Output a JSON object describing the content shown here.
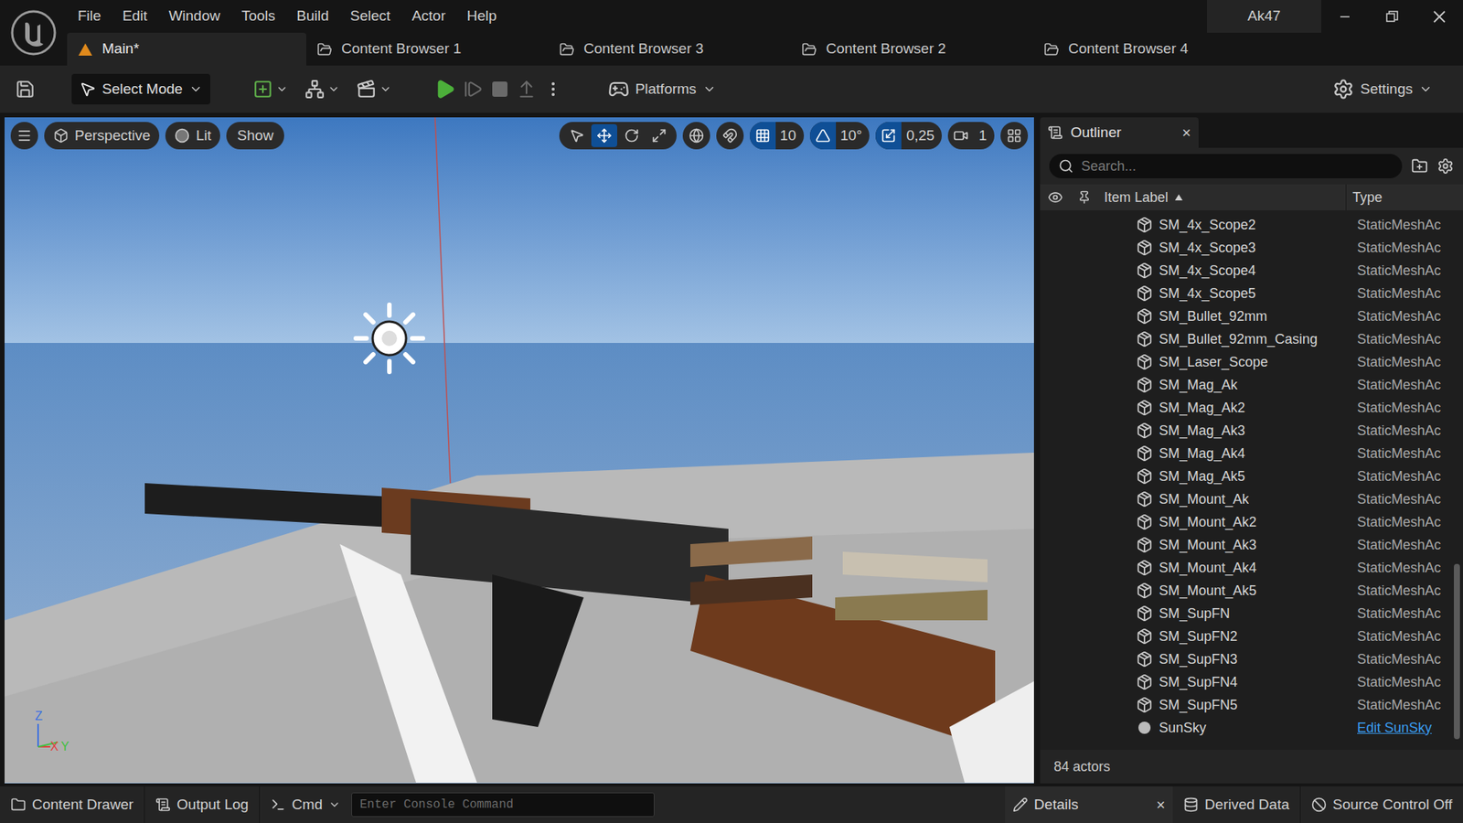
{
  "window": {
    "title": "Ak47"
  },
  "menu": [
    "File",
    "Edit",
    "Window",
    "Tools",
    "Build",
    "Select",
    "Actor",
    "Help"
  ],
  "tabs": [
    {
      "label": "Main*",
      "selected": true
    },
    {
      "label": "Content Browser 1",
      "selected": false
    },
    {
      "label": "Content Browser 3",
      "selected": false
    },
    {
      "label": "Content Browser 2",
      "selected": false
    },
    {
      "label": "Content Browser 4",
      "selected": false
    }
  ],
  "toolbar": {
    "mode": "Select Mode",
    "platforms": "Platforms",
    "settings": "Settings"
  },
  "viewport": {
    "view": "Perspective",
    "lighting": "Lit",
    "show": "Show",
    "transform_tools": [
      {
        "kind": "select",
        "selected": false
      },
      {
        "kind": "translate",
        "selected": true
      },
      {
        "kind": "rotate",
        "selected": false
      },
      {
        "kind": "scale",
        "selected": false
      }
    ],
    "snaps": [
      {
        "kind": "grid",
        "value": "10",
        "active": true
      },
      {
        "kind": "angle",
        "value": "10°",
        "active": true
      },
      {
        "kind": "scale",
        "value": "0,25",
        "active": true
      },
      {
        "kind": "camera",
        "value": "1",
        "active": false
      }
    ],
    "axes": [
      "Z",
      "X",
      "Y"
    ]
  },
  "outliner": {
    "title": "Outliner",
    "close": "×",
    "search_placeholder": "Search...",
    "columns": [
      "Item Label",
      "Type"
    ],
    "rows": [
      {
        "label": "SM_4x_Scope2",
        "type": "StaticMeshAc",
        "kind": "mesh"
      },
      {
        "label": "SM_4x_Scope3",
        "type": "StaticMeshAc",
        "kind": "mesh"
      },
      {
        "label": "SM_4x_Scope4",
        "type": "StaticMeshAc",
        "kind": "mesh"
      },
      {
        "label": "SM_4x_Scope5",
        "type": "StaticMeshAc",
        "kind": "mesh"
      },
      {
        "label": "SM_Bullet_92mm",
        "type": "StaticMeshAc",
        "kind": "mesh"
      },
      {
        "label": "SM_Bullet_92mm_Casing",
        "type": "StaticMeshAc",
        "kind": "mesh"
      },
      {
        "label": "SM_Laser_Scope",
        "type": "StaticMeshAc",
        "kind": "mesh"
      },
      {
        "label": "SM_Mag_Ak",
        "type": "StaticMeshAc",
        "kind": "mesh"
      },
      {
        "label": "SM_Mag_Ak2",
        "type": "StaticMeshAc",
        "kind": "mesh"
      },
      {
        "label": "SM_Mag_Ak3",
        "type": "StaticMeshAc",
        "kind": "mesh"
      },
      {
        "label": "SM_Mag_Ak4",
        "type": "StaticMeshAc",
        "kind": "mesh"
      },
      {
        "label": "SM_Mag_Ak5",
        "type": "StaticMeshAc",
        "kind": "mesh"
      },
      {
        "label": "SM_Mount_Ak",
        "type": "StaticMeshAc",
        "kind": "mesh"
      },
      {
        "label": "SM_Mount_Ak2",
        "type": "StaticMeshAc",
        "kind": "mesh"
      },
      {
        "label": "SM_Mount_Ak3",
        "type": "StaticMeshAc",
        "kind": "mesh"
      },
      {
        "label": "SM_Mount_Ak4",
        "type": "StaticMeshAc",
        "kind": "mesh"
      },
      {
        "label": "SM_Mount_Ak5",
        "type": "StaticMeshAc",
        "kind": "mesh"
      },
      {
        "label": "SM_SupFN",
        "type": "StaticMeshAc",
        "kind": "mesh"
      },
      {
        "label": "SM_SupFN2",
        "type": "StaticMeshAc",
        "kind": "mesh"
      },
      {
        "label": "SM_SupFN3",
        "type": "StaticMeshAc",
        "kind": "mesh"
      },
      {
        "label": "SM_SupFN4",
        "type": "StaticMeshAc",
        "kind": "mesh"
      },
      {
        "label": "SM_SupFN5",
        "type": "StaticMeshAc",
        "kind": "mesh"
      },
      {
        "label": "SunSky",
        "type": "Edit SunSky",
        "kind": "link"
      }
    ],
    "count": "84 actors"
  },
  "status_bar": {
    "content_drawer": "Content Drawer",
    "output_log": "Output Log",
    "cmd": "Cmd",
    "console_placeholder": "Enter Console Command",
    "details": "Details",
    "details_close": "×",
    "derived_data": "Derived Data",
    "source_control": "Source Control Off"
  }
}
